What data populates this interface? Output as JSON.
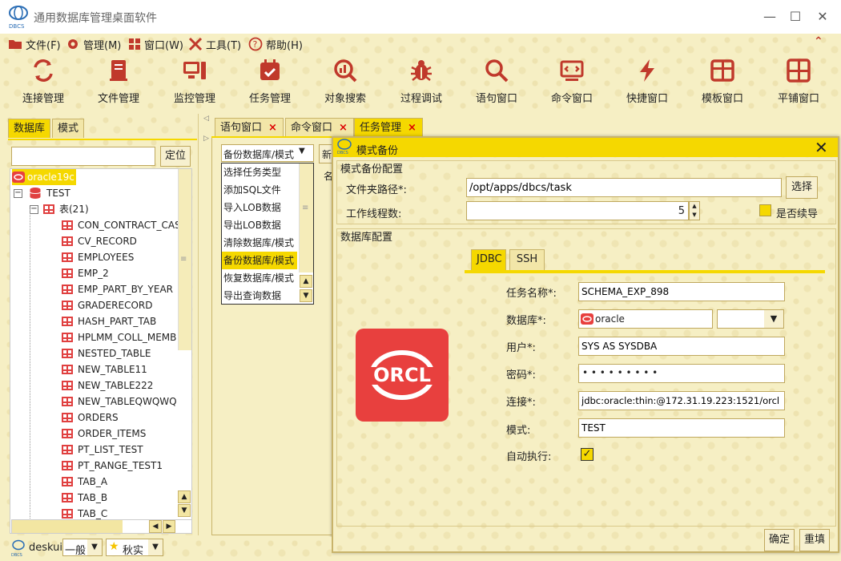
{
  "window": {
    "title": "通用数据库管理桌面软件",
    "app_logo": "DBCS"
  },
  "menu": [
    {
      "label": "文件(F)",
      "icon": "folder-icon"
    },
    {
      "label": "管理(M)",
      "icon": "gear-icon"
    },
    {
      "label": "窗口(W)",
      "icon": "windows-icon"
    },
    {
      "label": "工具(T)",
      "icon": "tools-icon"
    },
    {
      "label": "帮助(H)",
      "icon": "help-icon"
    }
  ],
  "toolbar": [
    {
      "label": "连接管理",
      "icon": "sync-icon"
    },
    {
      "label": "文件管理",
      "icon": "file-icon"
    },
    {
      "label": "监控管理",
      "icon": "monitor-icon"
    },
    {
      "label": "任务管理",
      "icon": "calendar-icon"
    },
    {
      "label": "对象搜索",
      "icon": "search-chart-icon"
    },
    {
      "label": "过程调试",
      "icon": "bug-icon"
    },
    {
      "label": "语句窗口",
      "icon": "search-icon"
    },
    {
      "label": "命令窗口",
      "icon": "terminal-icon"
    },
    {
      "label": "快捷窗口",
      "icon": "lightning-icon"
    },
    {
      "label": "模板窗口",
      "icon": "template-icon"
    },
    {
      "label": "平铺窗口",
      "icon": "grid-icon"
    }
  ],
  "left_panel": {
    "tabs": [
      "数据库",
      "模式"
    ],
    "locate_button": "定位",
    "search_value": "",
    "tree": {
      "connection": "oracle19c",
      "schema": "TEST",
      "table_group": "表(21)",
      "tables": [
        "CON_CONTRACT_CASE",
        "CV_RECORD",
        "EMPLOYEES",
        "EMP_2",
        "EMP_PART_BY_YEAR",
        "GRADERECORD",
        "HASH_PART_TAB",
        "HPLMM_COLL_MEMB",
        "NESTED_TABLE",
        "NEW_TABLE11",
        "NEW_TABLE222",
        "NEW_TABLEQWQWQ",
        "ORDERS",
        "ORDER_ITEMS",
        "PT_LIST_TEST",
        "PT_RANGE_TEST1",
        "TAB_A",
        "TAB_B",
        "TAB_C"
      ]
    }
  },
  "editor_tabs": [
    {
      "label": "语句窗口",
      "close": "×"
    },
    {
      "label": "命令窗口",
      "close": "×"
    },
    {
      "label": "任务管理",
      "close": "×"
    }
  ],
  "task_panel": {
    "task_type_value": "备份数据库/模式",
    "new_button": "新",
    "col_label": "名",
    "dropdown": [
      "选择任务类型",
      "添加SQL文件",
      "导入LOB数据",
      "导出LOB数据",
      "清除数据库/模式",
      "备份数据库/模式",
      "恢复数据库/模式",
      "导出查询数据"
    ],
    "dropdown_selected": 5
  },
  "dialog": {
    "title": "模式备份",
    "group1": "模式备份配置",
    "folder_label": "文件夹路径*:",
    "folder_value": "/opt/apps/dbcs/task",
    "choose_button": "选择",
    "threads_label": "工作线程数:",
    "threads_value": "5",
    "resume_label": "是否续导",
    "resume_checked": false,
    "group2": "数据库配置",
    "db_tabs": [
      "JDBC",
      "SSH"
    ],
    "logo_text": "ORCL",
    "logo_color": "#e8403e",
    "fields": {
      "task_name_label": "任务名称*:",
      "task_name_value": "SCHEMA_EXP_898",
      "db_label": "数据库*:",
      "db_value": "oracle",
      "user_label": "用户*:",
      "user_value": "SYS AS SYSDBA",
      "pwd_label": "密码*:",
      "pwd_value": "• • • • • • • • •",
      "conn_label": "连接*:",
      "conn_value": "jdbc:oracle:thin:@172.31.19.223:1521/orcl",
      "schema_label": "模式:",
      "schema_value": "TEST",
      "auto_label": "自动执行:",
      "auto_checked": true
    },
    "ok_button": "确定",
    "reset_button": "重填"
  },
  "statusbar": {
    "user": "deskui",
    "level": "一般",
    "theme": "秋实"
  },
  "colors": {
    "accent": "#f5d800",
    "table_icon": "#e04040",
    "background": "#f6efc4"
  }
}
